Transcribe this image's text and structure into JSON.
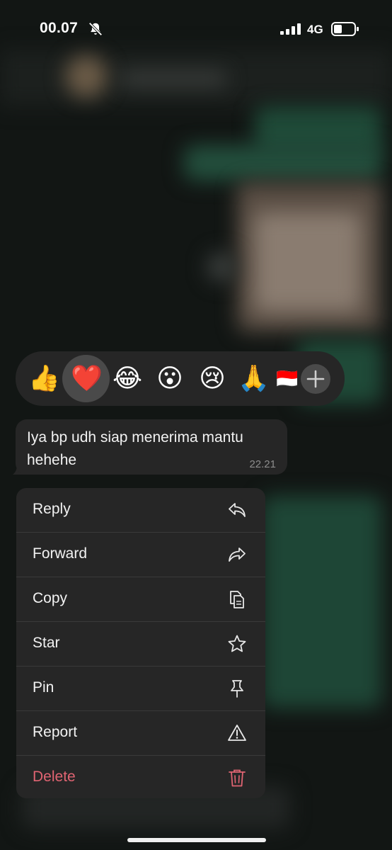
{
  "status_bar": {
    "time": "00.07",
    "network": "4G",
    "icons": [
      "bell-slash-icon",
      "signal-icon",
      "battery-icon"
    ]
  },
  "reactions": {
    "items": [
      {
        "name": "thumbs-up",
        "glyph": "👍"
      },
      {
        "name": "red-heart",
        "glyph": "❤️",
        "selected": true
      },
      {
        "name": "tears-of-joy",
        "glyph": "😂"
      },
      {
        "name": "surprised",
        "glyph": "😮"
      },
      {
        "name": "crying",
        "glyph": "😢"
      },
      {
        "name": "folded-hands",
        "glyph": "🙏"
      },
      {
        "name": "indonesia-flag",
        "glyph": "🇮🇩"
      }
    ],
    "more_icon": "plus-icon"
  },
  "message": {
    "text": "Iya bp udh siap menerima mantu hehehe",
    "time": "22.21"
  },
  "menu": {
    "items": [
      {
        "label": "Reply",
        "icon": "reply-icon"
      },
      {
        "label": "Forward",
        "icon": "forward-icon"
      },
      {
        "label": "Copy",
        "icon": "copy-icon"
      },
      {
        "label": "Star",
        "icon": "star-icon"
      },
      {
        "label": "Pin",
        "icon": "pin-icon"
      },
      {
        "label": "Report",
        "icon": "warning-icon"
      },
      {
        "label": "Delete",
        "icon": "trash-icon",
        "destructive": true
      }
    ]
  },
  "colors": {
    "menu_background": "#262626",
    "destructive": "#e06472",
    "timestamp": "#8d8d8d"
  }
}
